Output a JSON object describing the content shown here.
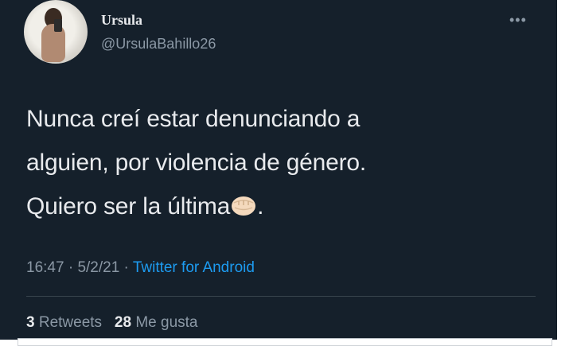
{
  "user": {
    "name": "Ursula",
    "handle": "@UrsulaBahillo26"
  },
  "more_menu": {
    "label": "•••",
    "icon": "more-horizontal-icon"
  },
  "tweet": {
    "line1": "Nunca creí estar denunciando a",
    "line2": "alguien, por violencia de género.",
    "line3": "Quiero ser la última",
    "line3_after_emoji": ".",
    "emoji_icon": "raised-fist-icon"
  },
  "meta": {
    "time": "16:47",
    "separator1": " · ",
    "date": "5/2/21",
    "separator2": " · ",
    "source": "Twitter for Android"
  },
  "stats": {
    "retweets_count": "3",
    "retweets_label": "Retweets",
    "likes_count": "28",
    "likes_label": "Me gusta"
  },
  "colors": {
    "background": "#15202b",
    "text": "#e8eaed",
    "secondary": "#8b98a5",
    "accent": "#1d9bf0"
  }
}
